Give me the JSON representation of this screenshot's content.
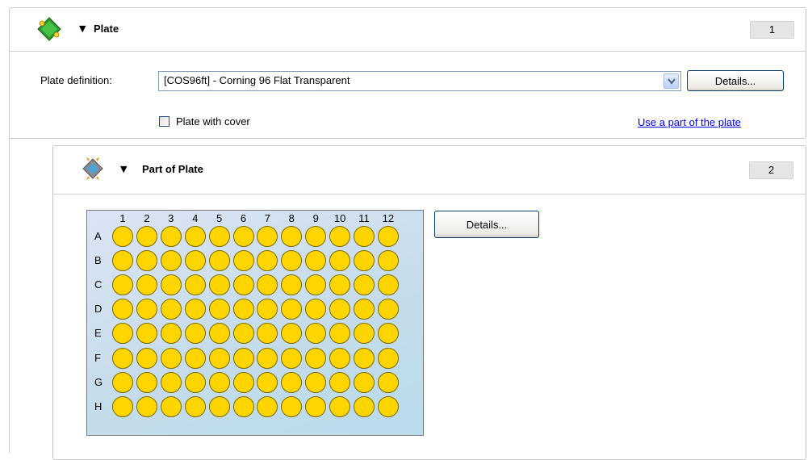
{
  "plate_section": {
    "title": "Plate",
    "number": "1",
    "definition_label": "Plate definition:",
    "definition_value": "[COS96ft] - Corning 96 Flat Transparent",
    "details_label": "Details...",
    "cover_label": "Plate with cover",
    "cover_checked": false,
    "part_link": "Use a part of the plate"
  },
  "part_section": {
    "title": "Part of Plate",
    "number": "2",
    "details_label": "Details...",
    "columns": [
      "1",
      "2",
      "3",
      "4",
      "5",
      "6",
      "7",
      "8",
      "9",
      "10",
      "11",
      "12"
    ],
    "rows": [
      "A",
      "B",
      "C",
      "D",
      "E",
      "F",
      "G",
      "H"
    ],
    "well_color": "#ffd500"
  },
  "icons": {
    "plate_icon": "green-plate-icon",
    "part_icon": "part-plate-icon",
    "collapse_arrow": "triangle-down-icon"
  }
}
